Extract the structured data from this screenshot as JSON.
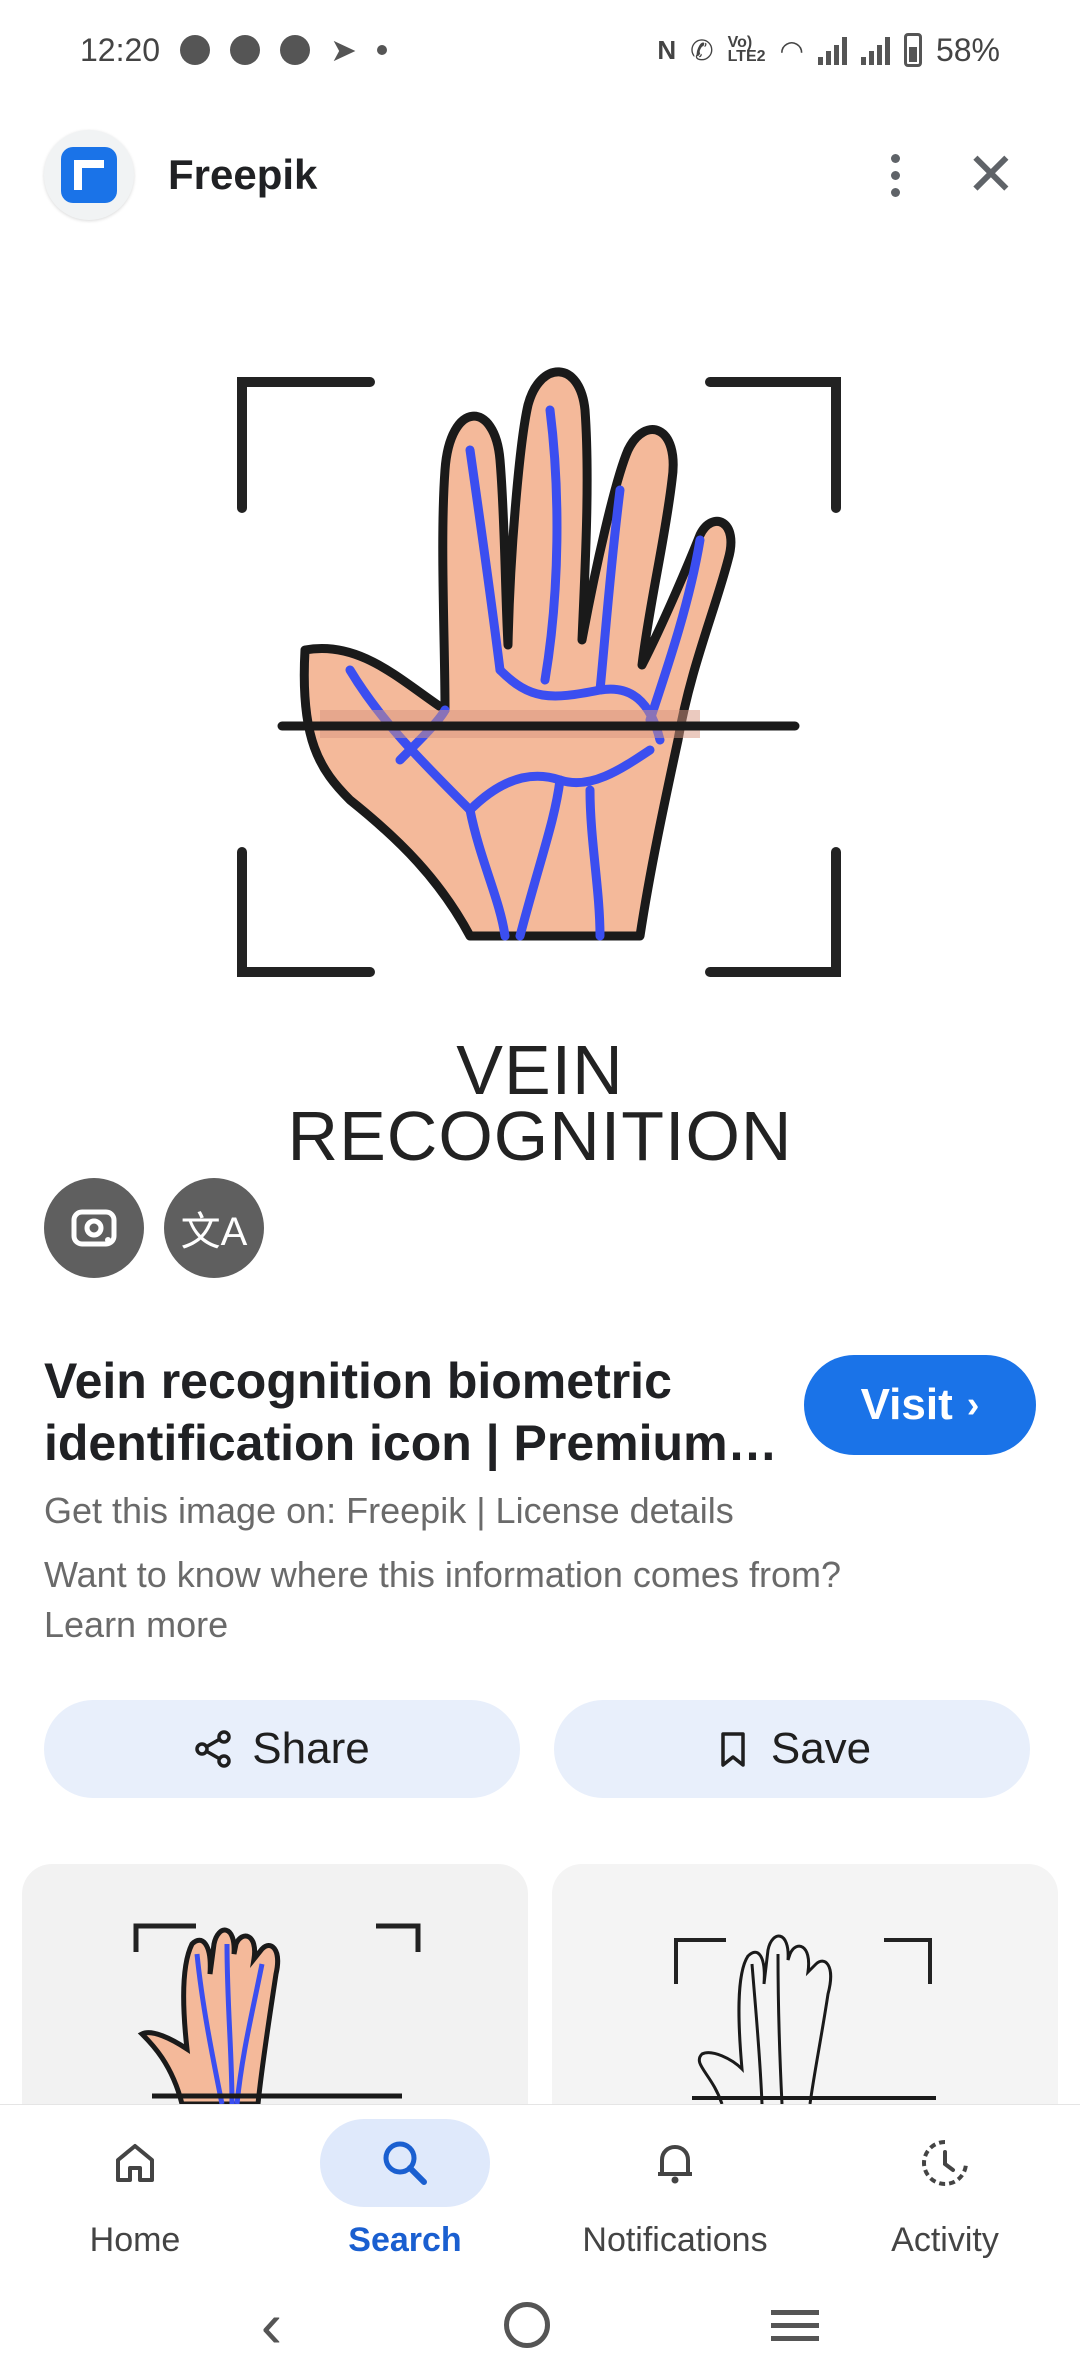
{
  "status_bar": {
    "time": "12:20",
    "battery": "58%",
    "left_icons": [
      "facebook-icon",
      "facebook-icon",
      "messenger-icon",
      "telegram-icon",
      "dot-icon"
    ],
    "right_icons": [
      "nfc-icon",
      "call-icon",
      "volte-icon",
      "wifi-icon",
      "signal-icon",
      "signal-icon",
      "battery-icon"
    ]
  },
  "app_bar": {
    "site_name": "Freepik",
    "favicon": "freepik-logo",
    "more_icon": "more-vert-icon",
    "close_icon": "close-icon"
  },
  "hero_image": {
    "caption_line1": "VEIN",
    "caption_line2": "RECOGNITION",
    "lens_icon": "google-lens-icon",
    "translate_icon": "translate-icon"
  },
  "result": {
    "title": "Vein recognition biometric identification icon | Premium…",
    "visit_label": "Visit",
    "source_text": "Get this image on: Freepik | License details",
    "info_text": "Want to know where this information comes from? Learn more"
  },
  "actions": {
    "share_label": "Share",
    "save_label": "Save"
  },
  "bottom_nav": {
    "items": [
      {
        "label": "Home",
        "icon": "home-icon"
      },
      {
        "label": "Search",
        "icon": "search-icon",
        "active": true
      },
      {
        "label": "Notifications",
        "icon": "bell-icon"
      },
      {
        "label": "Activity",
        "icon": "activity-icon"
      }
    ]
  },
  "colors": {
    "accent": "#1a73e8",
    "pill_bg": "#e8effb",
    "vein_blue": "#3b4ef0",
    "skin": "#f4b99a"
  }
}
